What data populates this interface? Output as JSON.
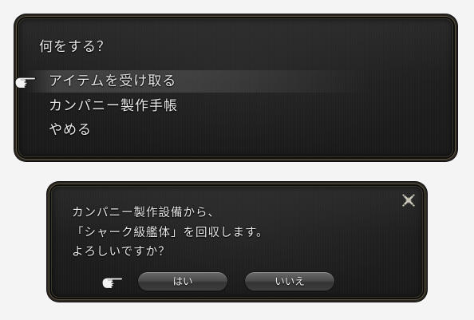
{
  "menu": {
    "title": "何をする？",
    "items": [
      {
        "label": "アイテムを受け取る",
        "selected": true
      },
      {
        "label": "カンパニー製作手帳",
        "selected": false
      },
      {
        "label": "やめる",
        "selected": false
      }
    ]
  },
  "dialog": {
    "message_lines": [
      "カンパニー製作設備から、",
      "「シャーク級艦体」を回収します。",
      "よろしいですか？"
    ],
    "yes_label": "はい",
    "no_label": "いいえ",
    "close_icon": "close-icon"
  },
  "icons": {
    "cursor": "pointing-hand-icon"
  },
  "colors": {
    "window_bg": "#1e1e1e",
    "window_border": "#5c5443",
    "text": "#e8e8e8",
    "page_bg": "#f4f4f4"
  }
}
